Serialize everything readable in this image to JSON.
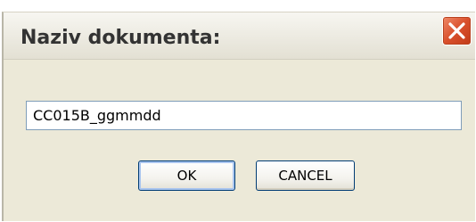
{
  "dialog": {
    "title": "Naziv dokumenta:",
    "close_icon": "close-icon",
    "input_value": "CC015B_ggmmdd",
    "ok_label": "OK",
    "cancel_label": "CANCEL"
  },
  "colors": {
    "dialog_background": "#ece9d8",
    "close_button": "#d9502c",
    "input_border": "#7f9db9",
    "button_border": "#003c74"
  }
}
